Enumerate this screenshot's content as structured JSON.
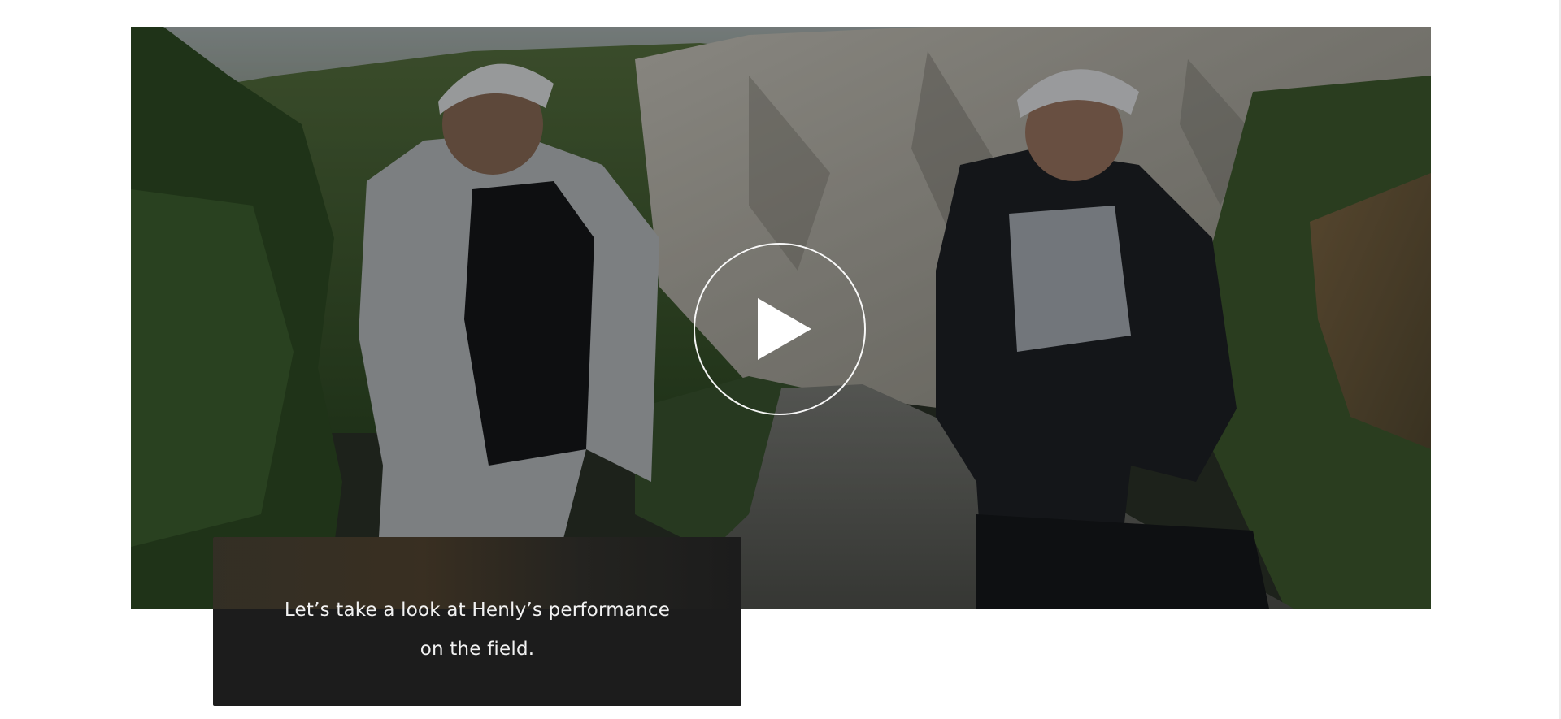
{
  "video": {
    "scene_description_icon": "video-thumbnail-cyclists",
    "play_icon": "play-icon"
  },
  "caption": {
    "line1": "Let’s take a look at Henly’s performance",
    "line2": "on the field."
  },
  "colors": {
    "page_background": "#ffffff",
    "caption_background": "#1c1c1c",
    "caption_text": "#f2f2f2",
    "play_outline": "#ffffff"
  }
}
